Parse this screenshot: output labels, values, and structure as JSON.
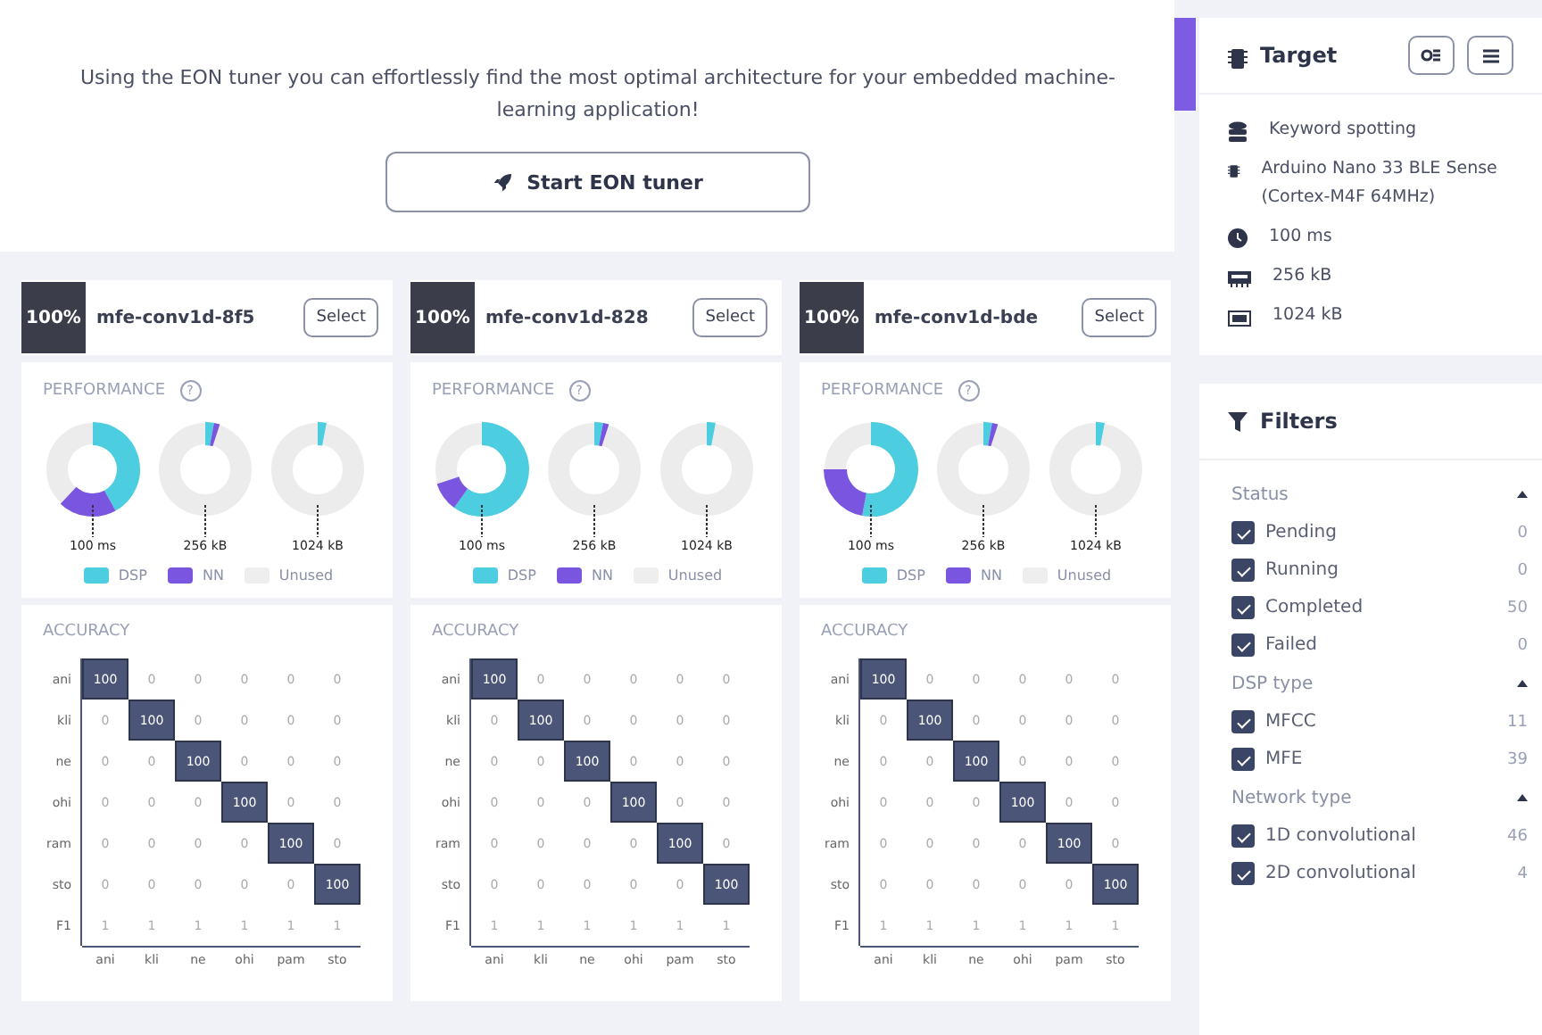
{
  "intro": {
    "text": "Using the EON tuner you can effortlessly find the most optimal architecture for your embedded machine-learning application!",
    "button": "Start EON tuner"
  },
  "cards": [
    {
      "score": "100%",
      "name": "mfe-conv1d-8f5",
      "button": "Select",
      "performance": {
        "title": "PERFORMANCE",
        "help": "?",
        "gauges": [
          "100 ms",
          "256 kB",
          "1024 kB"
        ]
      },
      "legend": [
        "DSP",
        "NN",
        "Unused"
      ],
      "accuracy": {
        "title": "ACCURACY",
        "row_labels": [
          "ani",
          "kli",
          "ne",
          "ohi",
          "ram",
          "sto",
          "F1"
        ],
        "column_labels": [
          "ani",
          "kli",
          "ne",
          "ohi",
          "pam",
          "sto"
        ],
        "rows": [
          [
            "100",
            "0",
            "0",
            "0",
            "0",
            "0"
          ],
          [
            "0",
            "100",
            "0",
            "0",
            "0",
            "0"
          ],
          [
            "0",
            "0",
            "100",
            "0",
            "0",
            "0"
          ],
          [
            "0",
            "0",
            "0",
            "100",
            "0",
            "0"
          ],
          [
            "0",
            "0",
            "0",
            "0",
            "100",
            "0"
          ],
          [
            "0",
            "0",
            "0",
            "0",
            "0",
            "100"
          ],
          [
            "1",
            "1",
            "1",
            "1",
            "1",
            "1"
          ]
        ]
      }
    },
    {
      "score": "100%",
      "name": "mfe-conv1d-828",
      "button": "Select",
      "performance": {
        "title": "PERFORMANCE",
        "help": "?",
        "gauges": [
          "100 ms",
          "256 kB",
          "1024 kB"
        ]
      },
      "legend": [
        "DSP",
        "NN",
        "Unused"
      ],
      "accuracy": {
        "title": "ACCURACY",
        "row_labels": [
          "ani",
          "kli",
          "ne",
          "ohi",
          "ram",
          "sto",
          "F1"
        ],
        "column_labels": [
          "ani",
          "kli",
          "ne",
          "ohi",
          "pam",
          "sto"
        ],
        "rows": [
          [
            "100",
            "0",
            "0",
            "0",
            "0",
            "0"
          ],
          [
            "0",
            "100",
            "0",
            "0",
            "0",
            "0"
          ],
          [
            "0",
            "0",
            "100",
            "0",
            "0",
            "0"
          ],
          [
            "0",
            "0",
            "0",
            "100",
            "0",
            "0"
          ],
          [
            "0",
            "0",
            "0",
            "0",
            "100",
            "0"
          ],
          [
            "0",
            "0",
            "0",
            "0",
            "0",
            "100"
          ],
          [
            "1",
            "1",
            "1",
            "1",
            "1",
            "1"
          ]
        ]
      }
    },
    {
      "score": "100%",
      "name": "mfe-conv1d-bde",
      "button": "Select",
      "performance": {
        "title": "PERFORMANCE",
        "help": "?",
        "gauges": [
          "100 ms",
          "256 kB",
          "1024 kB"
        ]
      },
      "legend": [
        "DSP",
        "NN",
        "Unused"
      ],
      "accuracy": {
        "title": "ACCURACY",
        "row_labels": [
          "ani",
          "kli",
          "ne",
          "ohi",
          "ram",
          "sto",
          "F1"
        ],
        "column_labels": [
          "ani",
          "kli",
          "ne",
          "ohi",
          "pam",
          "sto"
        ],
        "rows": [
          [
            "100",
            "0",
            "0",
            "0",
            "0",
            "0"
          ],
          [
            "0",
            "100",
            "0",
            "0",
            "0",
            "0"
          ],
          [
            "0",
            "0",
            "100",
            "0",
            "0",
            "0"
          ],
          [
            "0",
            "0",
            "0",
            "100",
            "0",
            "0"
          ],
          [
            "0",
            "0",
            "0",
            "0",
            "100",
            "0"
          ],
          [
            "0",
            "0",
            "0",
            "0",
            "0",
            "100"
          ],
          [
            "1",
            "1",
            "1",
            "1",
            "1",
            "1"
          ]
        ]
      }
    }
  ],
  "target": {
    "title": "Target",
    "items": [
      {
        "kind": "dataset",
        "text": "Keyword spotting"
      },
      {
        "kind": "chip",
        "text": "Arduino Nano 33 BLE Sense (Cortex-M4F 64MHz)"
      },
      {
        "kind": "clock",
        "text": "100 ms"
      },
      {
        "kind": "ram",
        "text": "256 kB"
      },
      {
        "kind": "rom",
        "text": "1024 kB"
      }
    ]
  },
  "filters": {
    "title": "Filters",
    "groups": [
      {
        "title": "Status",
        "expanded": true,
        "options": [
          {
            "label": "Pending",
            "count": "0",
            "checked": true
          },
          {
            "label": "Running",
            "count": "0",
            "checked": true
          },
          {
            "label": "Completed",
            "count": "50",
            "checked": true
          },
          {
            "label": "Failed",
            "count": "0",
            "checked": true
          }
        ]
      },
      {
        "title": "DSP type",
        "expanded": true,
        "options": [
          {
            "label": "MFCC",
            "count": "11",
            "checked": true
          },
          {
            "label": "MFE",
            "count": "39",
            "checked": true
          }
        ]
      },
      {
        "title": "Network type",
        "expanded": true,
        "options": [
          {
            "label": "1D convolutional",
            "count": "46",
            "checked": true
          },
          {
            "label": "2D convolutional",
            "count": "4",
            "checked": true
          }
        ]
      }
    ]
  }
}
